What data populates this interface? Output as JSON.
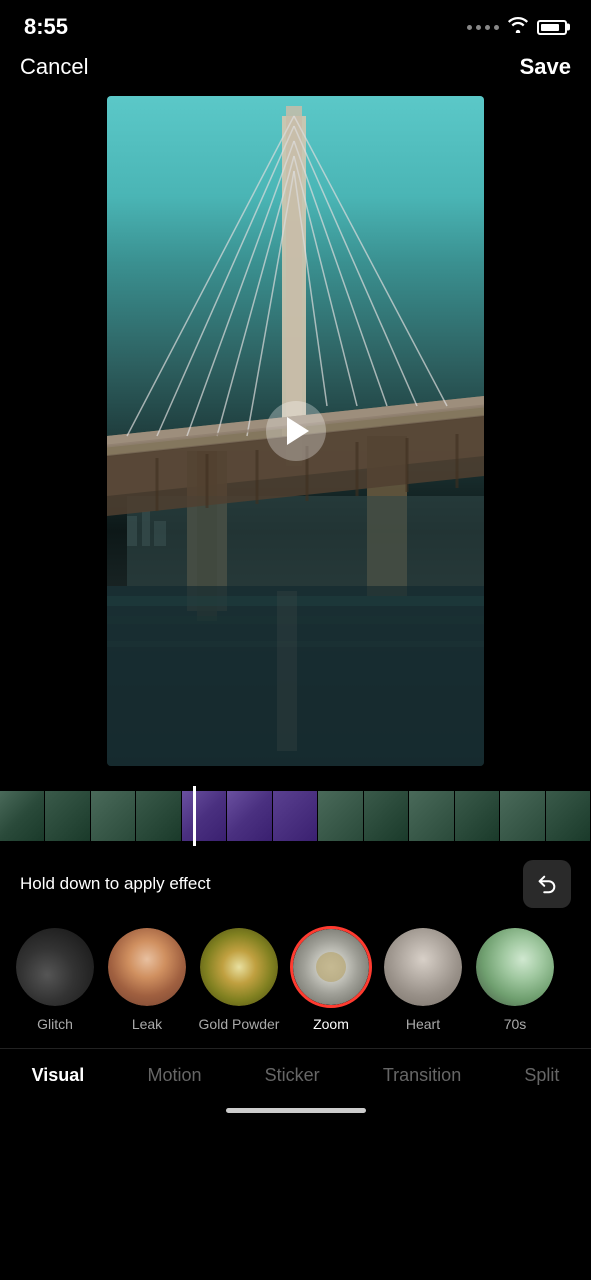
{
  "statusBar": {
    "time": "8:55"
  },
  "topBar": {
    "cancel": "Cancel",
    "save": "Save"
  },
  "holdDown": {
    "text": "Hold down to apply effect"
  },
  "effects": [
    {
      "id": "glitch",
      "label": "Glitch",
      "thumbClass": "thumb-glitch",
      "selected": false
    },
    {
      "id": "leak",
      "label": "Leak",
      "thumbClass": "thumb-leak",
      "selected": false
    },
    {
      "id": "gold-powder",
      "label": "Gold Powder",
      "thumbClass": "thumb-goldpowder",
      "selected": false
    },
    {
      "id": "zoom",
      "label": "Zoom",
      "thumbClass": "thumb-zoom",
      "selected": true
    },
    {
      "id": "heart",
      "label": "Heart",
      "thumbClass": "thumb-heart",
      "selected": false
    },
    {
      "id": "70s",
      "label": "70s",
      "thumbClass": "thumb-70s",
      "selected": false
    }
  ],
  "bottomNav": [
    {
      "id": "visual",
      "label": "Visual",
      "active": true
    },
    {
      "id": "motion",
      "label": "Motion",
      "active": false
    },
    {
      "id": "sticker",
      "label": "Sticker",
      "active": false
    },
    {
      "id": "transition",
      "label": "Transition",
      "active": false
    },
    {
      "id": "split",
      "label": "Split",
      "active": false
    }
  ]
}
